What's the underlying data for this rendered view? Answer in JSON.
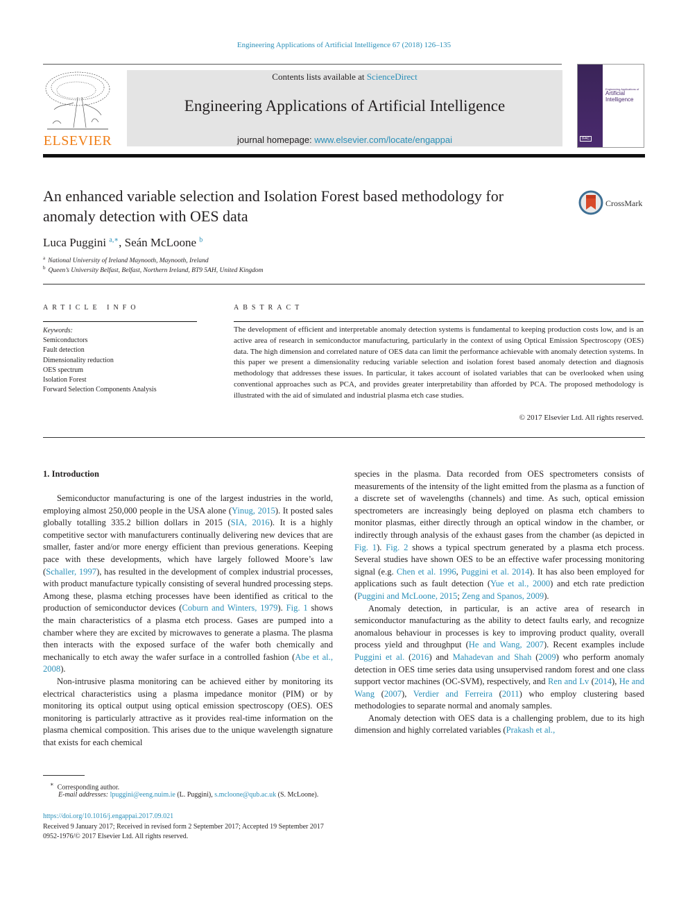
{
  "running_head": "Engineering Applications of Artificial Intelligence 67 (2018) 126–135",
  "header": {
    "publisher": "ELSEVIER",
    "contents_prefix": "Contents lists available at ",
    "contents_link": "ScienceDirect",
    "journal_title": "Engineering Applications of Artificial Intelligence",
    "homepage_prefix": "journal homepage: ",
    "homepage_link": "www.elsevier.com/locate/engappai",
    "cover_line1": "Engineering Applications of",
    "cover_line2": "Artificial",
    "cover_line3": "Intelligence",
    "cover_badge": "IFAC"
  },
  "article": {
    "title_line1": "An enhanced variable selection and Isolation Forest based methodology for",
    "title_line2": "anomaly detection with OES data",
    "crossmark": "CrossMark",
    "author1": "Luca Puggini",
    "author1_sup": "a,∗",
    "author2": "Seán McLoone",
    "author2_sup": "b",
    "affiliations": [
      {
        "mark": "a",
        "text": "National University of Ireland Maynooth, Maynooth, Ireland"
      },
      {
        "mark": "b",
        "text": "Queen’s University Belfast, Belfast, Northern Ireland, BT9 5AH, United Kingdom"
      }
    ]
  },
  "article_info": {
    "heading": "ARTICLE INFO",
    "keywords_label": "Keywords:",
    "keywords": [
      "Semiconductors",
      "Fault detection",
      "Dimensionality reduction",
      "OES spectrum",
      "Isolation Forest",
      "Forward Selection Components Analysis"
    ]
  },
  "abstract": {
    "heading": "ABSTRACT",
    "text": "The development of efficient and interpretable anomaly detection systems is fundamental to keeping production costs low, and is an active area of research in semiconductor manufacturing, particularly in the context of using Optical Emission Spectroscopy (OES) data. The high dimension and correlated nature of OES data can limit the performance achievable with anomaly detection systems. In this paper we present a dimensionality reducing variable selection and isolation forest based anomaly detection and diagnosis methodology that addresses these issues. In particular, it takes account of isolated variables that can be overlooked when using conventional approaches such as PCA, and provides greater interpretability than afforded by PCA. The proposed methodology is illustrated with the aid of simulated and industrial plasma etch case studies.",
    "copyright": "© 2017 Elsevier Ltd. All rights reserved."
  },
  "body": {
    "section_heading": "1.  Introduction",
    "col1": [
      [
        {
          "t": "Semiconductor manufacturing is one of the largest industries in the world, employing almost 250,000 people in the USA alone ("
        },
        {
          "l": "Yinug, 2015"
        },
        {
          "t": "). It posted sales globally totalling 335.2 billion dollars in 2015 ("
        },
        {
          "l": "SIA, 2016"
        },
        {
          "t": "). It is a highly competitive sector with manufacturers con­tinually delivering new devices that are smaller, faster and/or more energy efficient than previous generations. Keeping pace with these de­velopments, which have largely followed Moore’s law ("
        },
        {
          "l": "Schaller, 1997"
        },
        {
          "t": "), has resulted in the development of complex industrial processes, with product manufacture typically consisting of several hundred processing steps. Among these, plasma etching processes have been identified as critical to the production of semiconductor devices ("
        },
        {
          "l": "Coburn and Winters, 1979"
        },
        {
          "t": "). "
        },
        {
          "l": "Fig. 1"
        },
        {
          "t": " shows the main characteristics of a plasma etch process. Gases are pumped into a chamber where they are excited by microwaves to generate a plasma. The plasma then interacts with the exposed surface of the wafer both chemically and mechanically to etch away the wafer surface in a controlled fashion ("
        },
        {
          "l": "Abe et al., 2008"
        },
        {
          "t": ")."
        }
      ],
      [
        {
          "t": "Non-intrusive plasma monitoring can be achieved either by monitor­ing its electrical characteristics using a plasma impedance monitor (PIM) or by monitoring its optical output using optical emission spectroscopy (OES). OES monitoring is particularly attractive as it provides real-time information on the plasma chemical composition. This arises due to the unique wavelength signature that exists for each chemical"
        }
      ]
    ],
    "col2": [
      [
        {
          "t": "species in the plasma. Data recorded from OES spectrometers consists of measurements of the intensity of the light emitted from the plasma as a function of a discrete set of wavelengths (channels) and time. As such, optical emission spectrometers are increasingly being deployed on plasma etch chambers to monitor plasmas, either directly through an optical window in the chamber, or indirectly through analysis of the exhaust gases from the chamber (as depicted in "
        },
        {
          "l": "Fig. 1"
        },
        {
          "t": "). "
        },
        {
          "l": "Fig. 2"
        },
        {
          "t": " shows a typical spectrum generated by a plasma etch process. Several studies have shown OES to be an effective wafer processing monitoring signal (e.g. "
        },
        {
          "l": "Chen et al. 1996"
        },
        {
          "t": ", "
        },
        {
          "l": "Puggini et al. 2014"
        },
        {
          "t": "). It has also been employed for applications such as fault detection ("
        },
        {
          "l": "Yue et al., 2000"
        },
        {
          "t": ") and etch rate prediction ("
        },
        {
          "l": "Puggini and McLoone, 2015"
        },
        {
          "t": "; "
        },
        {
          "l": "Zeng and Spanos, 2009"
        },
        {
          "t": ")."
        }
      ],
      [
        {
          "t": "Anomaly detection, in particular, is an active area of research in semiconductor manufacturing as the ability to detect faults early, and recognize anomalous behaviour in processes is key to improving product quality, overall process yield and throughput ("
        },
        {
          "l": "He and Wang, 2007"
        },
        {
          "t": "). Recent examples include "
        },
        {
          "l": "Puggini et al."
        },
        {
          "t": " ("
        },
        {
          "l": "2016"
        },
        {
          "t": ") and "
        },
        {
          "l": "Mahadevan and Shah"
        },
        {
          "t": " ("
        },
        {
          "l": "2009"
        },
        {
          "t": ") who perform anomaly detection in OES time series data using unsupervised random forest and one class support vector machines (OC-SVM), respectively, and "
        },
        {
          "l": "Ren and Lv"
        },
        {
          "t": " ("
        },
        {
          "l": "2014"
        },
        {
          "t": "), "
        },
        {
          "l": "He and Wang"
        },
        {
          "t": " ("
        },
        {
          "l": "2007"
        },
        {
          "t": "), "
        },
        {
          "l": "Verdier and Ferreira"
        },
        {
          "t": " ("
        },
        {
          "l": "2011"
        },
        {
          "t": ") who employ clustering based methodologies to separate normal and anomaly samples."
        }
      ],
      [
        {
          "t": "Anomaly detection with OES data is a challenging problem, due to its high dimension and highly correlated variables ("
        },
        {
          "l": "Prakash et al.,"
        }
      ]
    ]
  },
  "footnotes": {
    "star": "∗",
    "corresponding": "Corresponding author.",
    "email_label": "E-mail addresses:",
    "email1": "lpuggini@eeng.nuim.ie",
    "email1_name": " (L. Puggini), ",
    "email2": "s.mcloone@qub.ac.uk",
    "email2_name": " (S. McLoone).",
    "doi": "https://doi.org/10.1016/j.engappai.2017.09.021",
    "received": "Received 9 January 2017; Received in revised form 2 September 2017; Accepted 19 September 2017",
    "issn": "0952-1976/© 2017 Elsevier Ltd.  All rights reserved."
  },
  "colors": {
    "link": "#2a8fb8",
    "elsevier_orange": "#f07e16",
    "header_box": "#e4e4e4",
    "cover_purple": "#4a2a6e"
  }
}
